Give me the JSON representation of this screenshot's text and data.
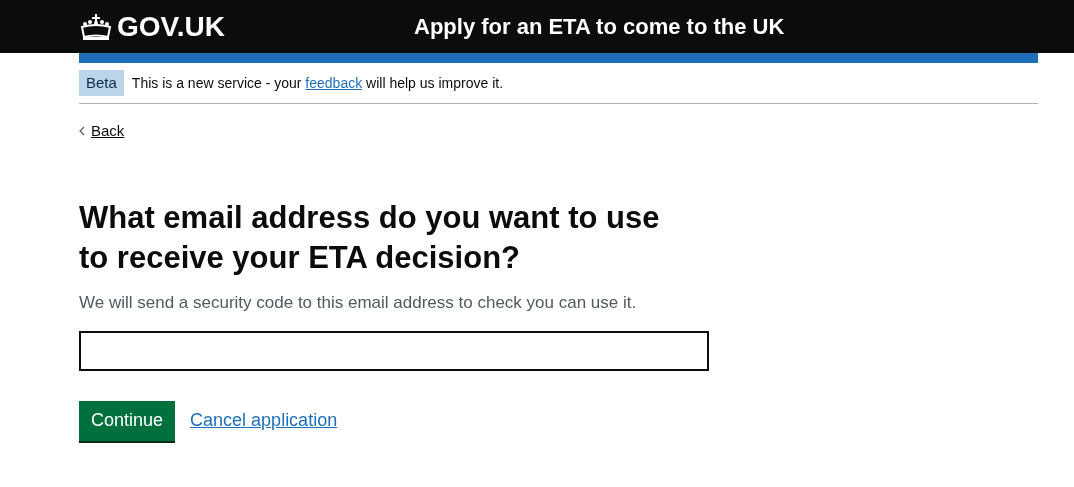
{
  "header": {
    "logo": "GOV.UK",
    "service_name": "Apply for an ETA to come to the UK"
  },
  "phase_banner": {
    "tag": "Beta",
    "text_before": "This is a new service - your",
    "link": "feedback",
    "text_after": "will help us improve it."
  },
  "back_link": "Back",
  "question": {
    "heading": "What email address do you want to use to receive your ETA decision?",
    "hint": "We will send a security code to this email address to check you can use it."
  },
  "actions": {
    "primary": "Continue",
    "secondary": "Cancel application"
  }
}
